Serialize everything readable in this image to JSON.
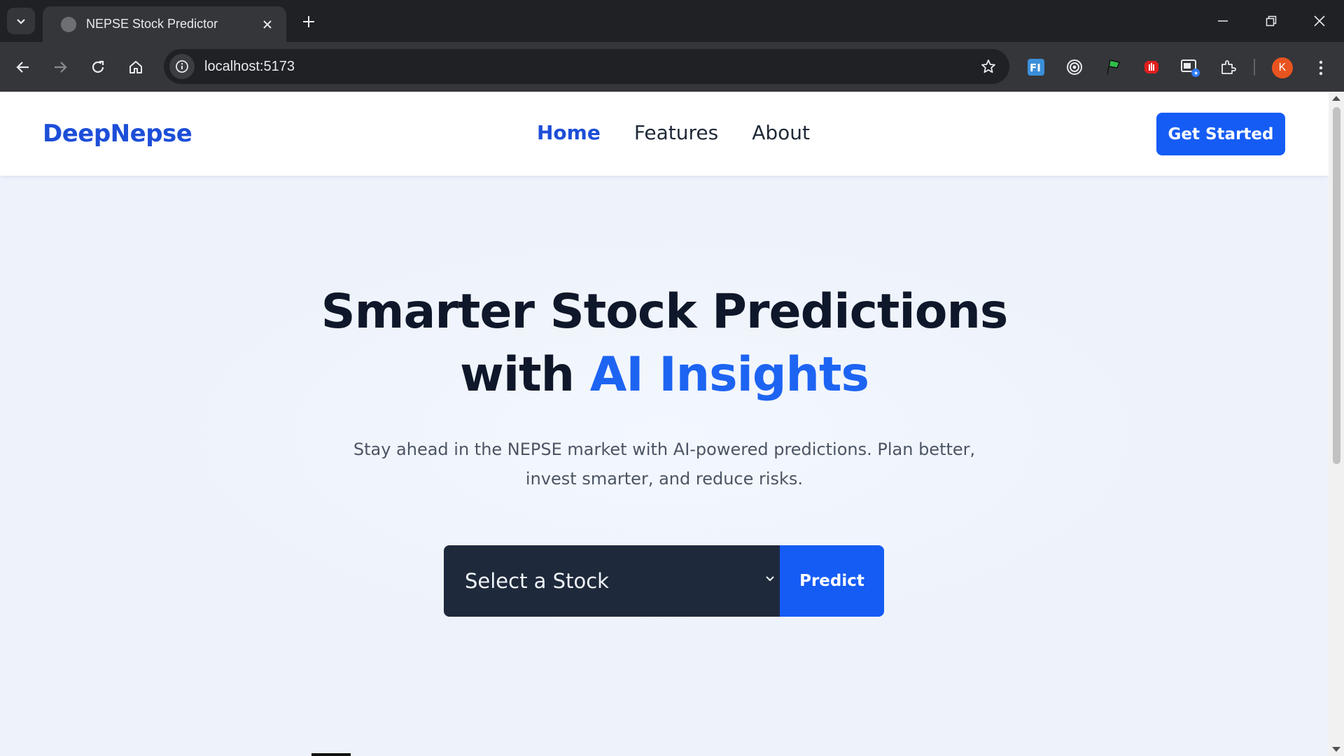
{
  "browser": {
    "tab_title": "NEPSE Stock Predictor",
    "url": "localhost:5173",
    "profile_initial": "K",
    "extensions": [
      "fi-extension-icon",
      "target-extension-icon",
      "flag-extension-icon",
      "stop-hand-extension-icon",
      "windows-extension-icon",
      "puzzle-extensions-icon"
    ]
  },
  "site": {
    "logo": "DeepNepse",
    "nav": {
      "home": "Home",
      "features": "Features",
      "about": "About"
    },
    "cta": "Get Started"
  },
  "hero": {
    "title_line1": "Smarter Stock Predictions",
    "title_with": "with",
    "title_accent": "AI Insights",
    "subtitle": "Stay ahead in the NEPSE market with AI-powered predictions. Plan better, invest smarter, and reduce risks."
  },
  "predictor": {
    "select_value": "Select a Stock",
    "button": "Predict"
  },
  "colors": {
    "brand": "#1d4ed8",
    "button": "#155cf5",
    "select_bg": "#1e293b"
  }
}
